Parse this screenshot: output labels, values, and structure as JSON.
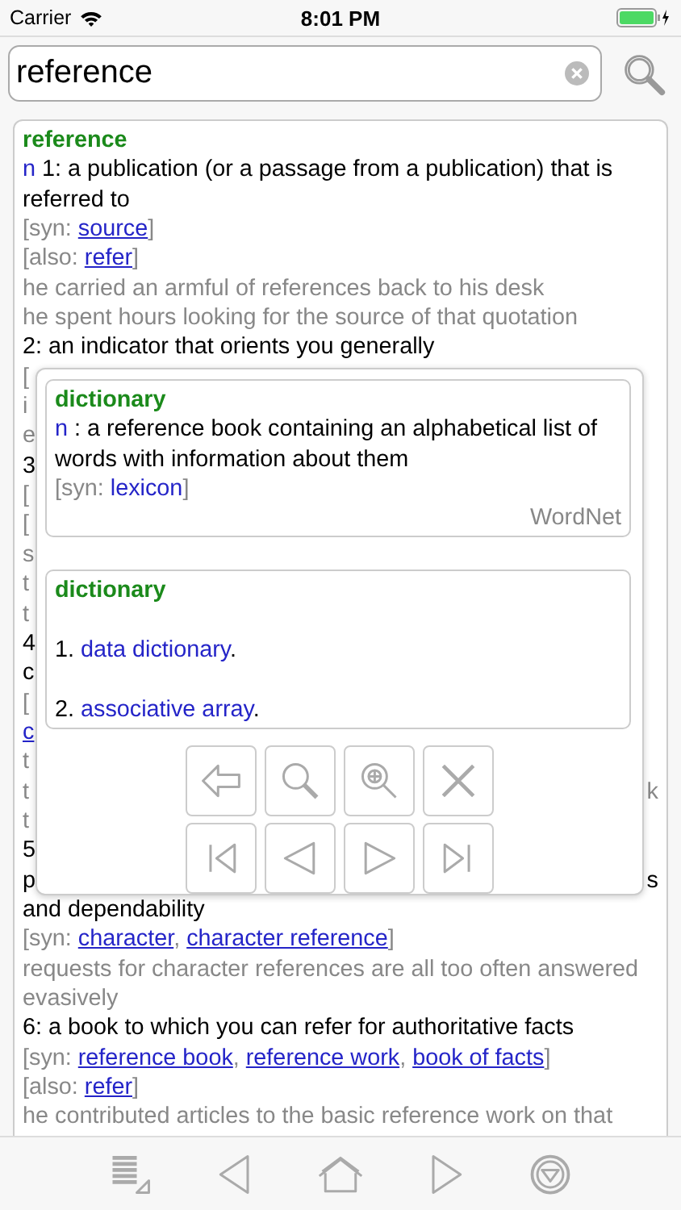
{
  "status_bar": {
    "carrier": "Carrier",
    "time": "8:01 PM"
  },
  "search": {
    "value": "reference"
  },
  "entry": {
    "lines": [
      {
        "kind": "headword",
        "parts": [
          {
            "t": "reference"
          }
        ]
      },
      {
        "kind": "sense",
        "parts": [
          {
            "pos": "n"
          },
          {
            "t": " 1: a publication (or a passage from a publication) that is referred to"
          }
        ]
      },
      {
        "kind": "refs",
        "parts": [
          {
            "t": "[syn: "
          },
          {
            "link": "source"
          },
          {
            "t": "]"
          }
        ]
      },
      {
        "kind": "refs",
        "parts": [
          {
            "t": "[also: "
          },
          {
            "link": "refer"
          },
          {
            "t": "]"
          }
        ]
      },
      {
        "kind": "example",
        "parts": [
          {
            "t": "he carried an armful of references back to his desk"
          }
        ]
      },
      {
        "kind": "example",
        "parts": [
          {
            "t": "he spent hours looking for the source of that quotation"
          }
        ]
      },
      {
        "kind": "sense",
        "parts": [
          {
            "t": "2: an indicator that orients you generally"
          }
        ]
      },
      {
        "kind": "refs",
        "parts": [
          {
            "t": "["
          }
        ]
      },
      {
        "kind": "example",
        "parts": [
          {
            "t": "i"
          }
        ]
      },
      {
        "kind": "example",
        "parts": [
          {
            "t": "e"
          }
        ]
      },
      {
        "kind": "sense",
        "parts": [
          {
            "t": "3"
          }
        ]
      },
      {
        "kind": "refs",
        "parts": [
          {
            "t": "["
          }
        ]
      },
      {
        "kind": "refs",
        "parts": [
          {
            "t": "["
          }
        ]
      },
      {
        "kind": "example",
        "parts": [
          {
            "t": "s"
          }
        ]
      },
      {
        "kind": "example",
        "parts": [
          {
            "t": "t"
          }
        ]
      },
      {
        "kind": "example",
        "parts": [
          {
            "t": "t"
          }
        ]
      },
      {
        "kind": "sense",
        "parts": [
          {
            "t": "4"
          }
        ]
      },
      {
        "kind": "sense",
        "parts": [
          {
            "t": "c"
          }
        ]
      },
      {
        "kind": "refs",
        "parts": [
          {
            "t": "["
          }
        ]
      },
      {
        "kind": "refs",
        "parts": [
          {
            "link": "c"
          }
        ]
      },
      {
        "kind": "example",
        "parts": [
          {
            "t": "t"
          }
        ]
      },
      {
        "kind": "example",
        "parts": [
          {
            "t": "t"
          }
        ],
        "right": "k"
      },
      {
        "kind": "example",
        "parts": [
          {
            "t": "t"
          }
        ]
      },
      {
        "kind": "sense",
        "parts": [
          {
            "t": "5"
          }
        ]
      },
      {
        "kind": "sense",
        "parts": [
          {
            "t": "p"
          }
        ],
        "right": "s"
      },
      {
        "kind": "sense",
        "parts": [
          {
            "t": "and dependability"
          }
        ]
      },
      {
        "kind": "refs",
        "parts": [
          {
            "t": "[syn: "
          },
          {
            "link": "character",
            "sep": ", "
          },
          {
            "link": "character reference"
          },
          {
            "t": "]"
          }
        ]
      },
      {
        "kind": "example",
        "parts": [
          {
            "t": "requests for character references are all too often answered evasively"
          }
        ]
      },
      {
        "kind": "sense",
        "parts": [
          {
            "t": "6: a book to which you can refer for authoritative facts"
          }
        ]
      },
      {
        "kind": "refs",
        "parts": [
          {
            "t": "[syn: "
          },
          {
            "link": "reference book",
            "sep": ", "
          },
          {
            "link": "reference work",
            "sep": ", "
          },
          {
            "link": "book of facts"
          },
          {
            "t": "]"
          }
        ]
      },
      {
        "kind": "refs",
        "parts": [
          {
            "t": "[also: "
          },
          {
            "link": "refer"
          },
          {
            "t": "]"
          }
        ]
      },
      {
        "kind": "example",
        "parts": [
          {
            "t": "he contributed articles to the basic reference work on that"
          }
        ]
      }
    ]
  },
  "popup": {
    "cards": [
      {
        "title": "dictionary",
        "lines": [
          {
            "kind": "sense",
            "parts": [
              {
                "pos": "n"
              },
              {
                "t": " : a reference book containing an alphabetical list of words with information about them"
              }
            ]
          },
          {
            "kind": "refs",
            "parts": [
              {
                "t": "[syn: "
              },
              {
                "link": "lexicon"
              },
              {
                "t": "]"
              }
            ]
          }
        ],
        "source": "WordNet"
      },
      {
        "title": "dictionary",
        "lines": [
          {
            "kind": "gap"
          },
          {
            "kind": "item",
            "parts": [
              {
                "t": "1. "
              },
              {
                "link": "data dictionary"
              },
              {
                "t": "."
              }
            ]
          },
          {
            "kind": "gap"
          },
          {
            "kind": "item",
            "parts": [
              {
                "t": "2. "
              },
              {
                "link": "associative array"
              },
              {
                "t": "."
              }
            ]
          }
        ]
      }
    ],
    "buttons": [
      {
        "kind": "back"
      },
      {
        "kind": "search"
      },
      {
        "kind": "zoom"
      },
      {
        "kind": "close"
      },
      {
        "kind": "first"
      },
      {
        "kind": "prev"
      },
      {
        "kind": "next"
      },
      {
        "kind": "last"
      }
    ]
  },
  "toolbar": [
    {
      "kind": "list"
    },
    {
      "kind": "back"
    },
    {
      "kind": "home"
    },
    {
      "kind": "forward"
    },
    {
      "kind": "menu"
    }
  ]
}
